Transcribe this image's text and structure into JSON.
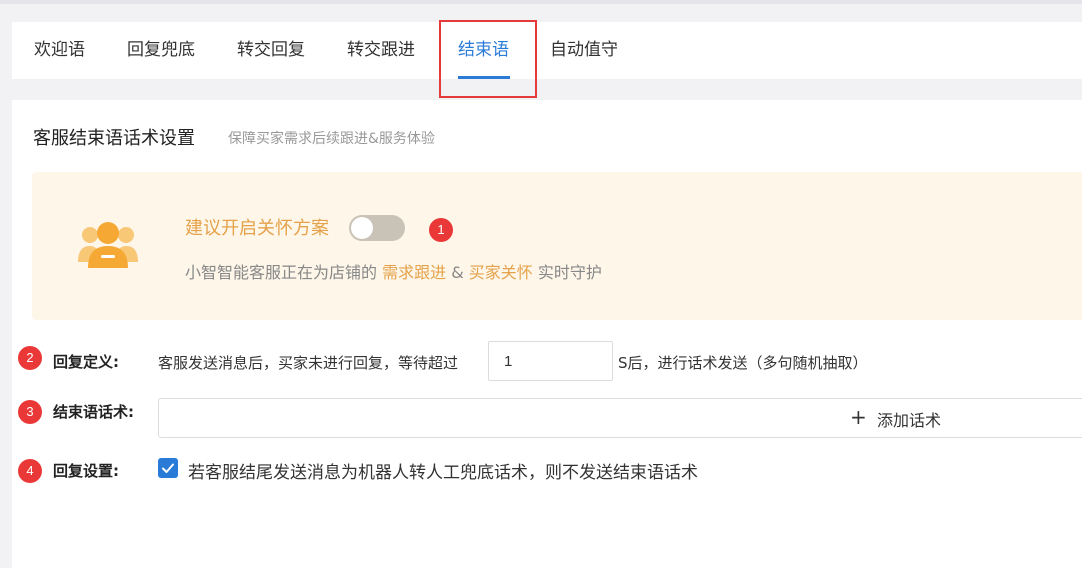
{
  "tabs": [
    {
      "label": "欢迎语",
      "active": false
    },
    {
      "label": "回复兜底",
      "active": false
    },
    {
      "label": "转交回复",
      "active": false
    },
    {
      "label": "转交跟进",
      "active": false
    },
    {
      "label": "结束语",
      "active": true
    },
    {
      "label": "自动值守",
      "active": false
    }
  ],
  "section": {
    "title": "客服结束语话术设置",
    "subtitle": "保障买家需求后续跟进&服务体验"
  },
  "banner": {
    "headline": "建议开启关怀方案",
    "toggle_on": false,
    "desc_prefix": "小智智能客服正在为店铺的",
    "desc_highlight1": "需求跟进",
    "desc_amp": "&",
    "desc_highlight2": "买家关怀",
    "desc_suffix": "实时守护"
  },
  "badges": [
    "1",
    "2",
    "3",
    "4"
  ],
  "reply_definition": {
    "label": "回复定义:",
    "text_before": "客服发送消息后，买家未进行回复，等待超过",
    "wait_value": "1",
    "text_after": "S后，进行话术发送（多句随机抽取）"
  },
  "ending_phrases": {
    "label": "结束语话术:",
    "add_label": "添加话术"
  },
  "reply_settings": {
    "label": "回复设置:",
    "checked": true,
    "checkbox_label": "若客服结尾发送消息为机器人转人工兜底话术，则不发送结束语话术"
  },
  "colors": {
    "accent": "#2a7bd8",
    "warning": "#e5a24a",
    "badge": "#ea3838"
  }
}
